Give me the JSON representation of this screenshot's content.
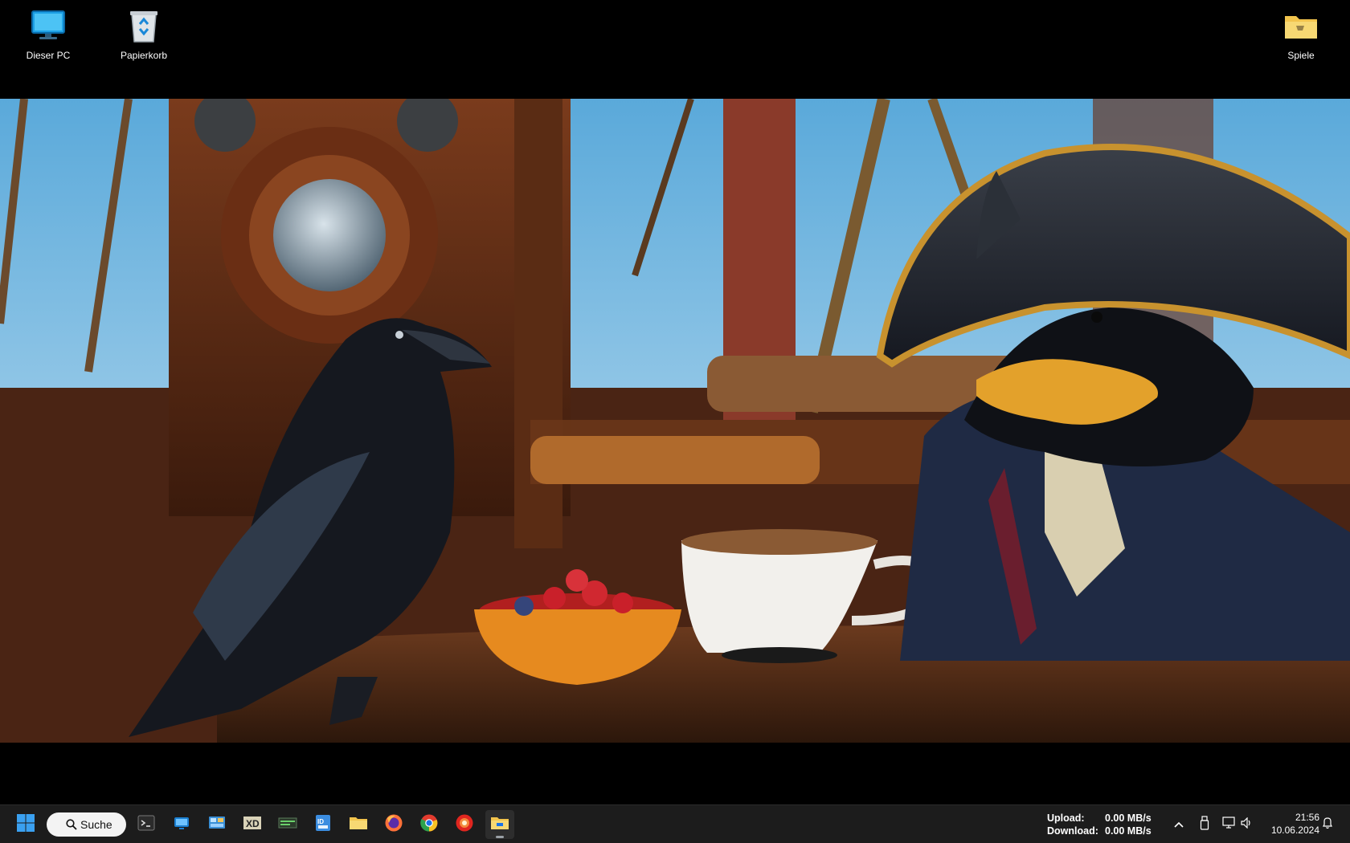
{
  "desktop": {
    "icons": [
      {
        "label": "Dieser PC",
        "icon": "computer-icon"
      },
      {
        "label": "Papierkorb",
        "icon": "recycle-bin-icon"
      },
      {
        "label": "Spiele",
        "icon": "folder-icon"
      }
    ]
  },
  "taskbar": {
    "start_icon": "windows-start-icon",
    "search_label": "Suche",
    "pinned_apps": [
      {
        "name": "terminal",
        "icon": "terminal-icon"
      },
      {
        "name": "remote-desktop",
        "icon": "remote-desktop-icon"
      },
      {
        "name": "control-panel",
        "icon": "control-panel-icon"
      },
      {
        "name": "xd-app",
        "icon": "xd-app-icon"
      },
      {
        "name": "gpu-monitor",
        "icon": "gpu-monitor-icon"
      },
      {
        "name": "id-app",
        "icon": "id-app-icon"
      },
      {
        "name": "file-explorer",
        "icon": "file-explorer-icon"
      },
      {
        "name": "firefox",
        "icon": "firefox-icon"
      },
      {
        "name": "chrome",
        "icon": "chrome-icon"
      },
      {
        "name": "red-browser",
        "icon": "red-circle-app-icon"
      },
      {
        "name": "folder-app",
        "icon": "folder-app-icon"
      }
    ],
    "net": {
      "upload_label": "Upload:",
      "upload_value": "0.00 MB/s",
      "download_label": "Download:",
      "download_value": "0.00 MB/s"
    },
    "tray": {
      "chevron": "chevron-up-icon",
      "usb": "usb-icon",
      "network": "network-icon",
      "volume": "volume-icon",
      "notifications": "bell-icon"
    },
    "clock": {
      "time": "21:56",
      "date": "10.06.2024"
    }
  },
  "colors": {
    "taskbar_bg": "#1c1c1c",
    "search_bg": "#f3f3f3",
    "accent_blue": "#0a84d8"
  }
}
